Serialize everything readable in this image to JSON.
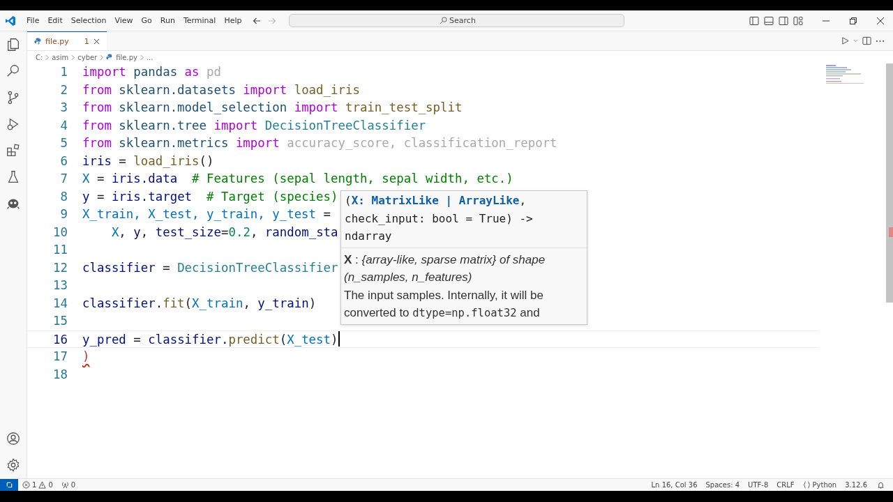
{
  "menu": [
    "File",
    "Edit",
    "Selection",
    "View",
    "Go",
    "Run",
    "Terminal",
    "Help"
  ],
  "search": {
    "placeholder": "Search"
  },
  "tabs": [
    {
      "label": "file.py",
      "badge": "1",
      "selected": true
    }
  ],
  "breadcrumb": [
    "C:",
    "asim",
    "cyber",
    "file.py",
    "..."
  ],
  "editor": {
    "lines": [
      {
        "number": "1",
        "current": false,
        "tokens": [
          {
            "text": "import",
            "kind": "kw"
          },
          {
            "text": " pandas ",
            "kind": "mod"
          },
          {
            "text": "as",
            "kind": "kw"
          },
          {
            "text": " pd",
            "kind": "dim"
          }
        ]
      },
      {
        "number": "2",
        "current": false,
        "tokens": [
          {
            "text": "from",
            "kind": "kw"
          },
          {
            "text": " sklearn.datasets ",
            "kind": "mod"
          },
          {
            "text": "import",
            "kind": "kw"
          },
          {
            "text": " load_iris",
            "kind": "fn"
          }
        ]
      },
      {
        "number": "3",
        "current": false,
        "tokens": [
          {
            "text": "from",
            "kind": "kw"
          },
          {
            "text": " sklearn.model_selection ",
            "kind": "mod"
          },
          {
            "text": "import",
            "kind": "kw"
          },
          {
            "text": " train_test_split",
            "kind": "fn"
          }
        ]
      },
      {
        "number": "4",
        "current": false,
        "tokens": [
          {
            "text": "from",
            "kind": "kw"
          },
          {
            "text": " sklearn.tree ",
            "kind": "mod"
          },
          {
            "text": "import",
            "kind": "kw"
          },
          {
            "text": " DecisionTreeClassifier",
            "kind": "cls"
          }
        ]
      },
      {
        "number": "5",
        "current": false,
        "tokens": [
          {
            "text": "from",
            "kind": "kw"
          },
          {
            "text": " sklearn.metrics ",
            "kind": "mod"
          },
          {
            "text": "import",
            "kind": "kw"
          },
          {
            "text": " accuracy_score, classification_report",
            "kind": "dim"
          }
        ]
      },
      {
        "number": "6",
        "current": false,
        "tokens": [
          {
            "text": "iris",
            "kind": "var"
          },
          {
            "text": " = ",
            "kind": "plain"
          },
          {
            "text": "load_iris",
            "kind": "fn"
          },
          {
            "text": "()",
            "kind": "plain"
          }
        ]
      },
      {
        "number": "7",
        "current": false,
        "tokens": [
          {
            "text": "X",
            "kind": "const"
          },
          {
            "text": " = ",
            "kind": "plain"
          },
          {
            "text": "iris.data",
            "kind": "var"
          },
          {
            "text": "  # Features (sepal length, sepal width, etc.)",
            "kind": "cmt"
          }
        ]
      },
      {
        "number": "8",
        "current": false,
        "tokens": [
          {
            "text": "y",
            "kind": "var"
          },
          {
            "text": " = ",
            "kind": "plain"
          },
          {
            "text": "iris.target",
            "kind": "var"
          },
          {
            "text": "  # Target (species)",
            "kind": "cmt"
          }
        ]
      },
      {
        "number": "9",
        "current": false,
        "tokens": [
          {
            "text": "X_train, X_test, y_train, y_test",
            "kind": "const"
          },
          {
            "text": " =",
            "kind": "plain"
          }
        ]
      },
      {
        "number": "10",
        "current": false,
        "tokens": [
          {
            "text": "    X",
            "kind": "const"
          },
          {
            "text": ", ",
            "kind": "plain"
          },
          {
            "text": "y",
            "kind": "var"
          },
          {
            "text": ", ",
            "kind": "plain"
          },
          {
            "text": "test_size",
            "kind": "var"
          },
          {
            "text": "=",
            "kind": "plain"
          },
          {
            "text": "0.2",
            "kind": "num"
          },
          {
            "text": ", ",
            "kind": "plain"
          },
          {
            "text": "random_sta",
            "kind": "var"
          }
        ]
      },
      {
        "number": "11",
        "current": false
      },
      {
        "number": "12",
        "current": false,
        "tokens": [
          {
            "text": "classifier",
            "kind": "var"
          },
          {
            "text": " = ",
            "kind": "plain"
          },
          {
            "text": "DecisionTreeClassifier",
            "kind": "cls"
          }
        ]
      },
      {
        "number": "13",
        "current": false
      },
      {
        "number": "14",
        "current": false,
        "tokens": [
          {
            "text": "classifier.",
            "kind": "var"
          },
          {
            "text": "fit",
            "kind": "fn"
          },
          {
            "text": "(",
            "kind": "plain"
          },
          {
            "text": "X_train",
            "kind": "const"
          },
          {
            "text": ", ",
            "kind": "plain"
          },
          {
            "text": "y_train",
            "kind": "var"
          },
          {
            "text": ")",
            "kind": "plain"
          }
        ]
      },
      {
        "number": "15",
        "current": false
      },
      {
        "number": "16",
        "current": true,
        "tokens": [
          {
            "text": "y_pred",
            "kind": "var"
          },
          {
            "text": " = ",
            "kind": "plain"
          },
          {
            "text": "classifier.",
            "kind": "var"
          },
          {
            "text": "predict",
            "kind": "fn"
          },
          {
            "text": "(",
            "kind": "plain"
          },
          {
            "text": "X_test",
            "kind": "const"
          },
          {
            "text": ")",
            "kind": "plain"
          }
        ]
      },
      {
        "number": "17",
        "current": false,
        "tokens": [
          {
            "text": ")",
            "kind": "err"
          }
        ]
      },
      {
        "number": "18",
        "current": false
      }
    ],
    "tooltip": {
      "signature": [
        [
          {
            "text": "(",
            "kind": "plain"
          },
          {
            "text": "X: MatrixLike | ArrayLike",
            "kind": "param"
          },
          {
            "text": ",",
            "kind": "plain"
          }
        ],
        [
          {
            "text": "check_input: bool = True) ->",
            "kind": "plain"
          }
        ],
        [
          {
            "text": "ndarray",
            "kind": "plain"
          }
        ]
      ],
      "param_doc": "**X** : *{array-like, sparse matrix} of shape (n_samples, n_features)*",
      "description": [
        {
          "text": "The input samples. Internally, it will be converted to ",
          "kind": "text"
        },
        {
          "text": "dtype=np.float32",
          "kind": "code"
        },
        {
          "text": " and",
          "kind": "text"
        }
      ]
    }
  },
  "status_bar": {
    "errors": "1",
    "warnings": "0",
    "ports": "0",
    "position": "Ln 16, Col 36",
    "indent": "Spaces: 4",
    "encoding": "UTF-8",
    "eol": "CRLF",
    "language": "Python",
    "version": "3.12.6"
  }
}
